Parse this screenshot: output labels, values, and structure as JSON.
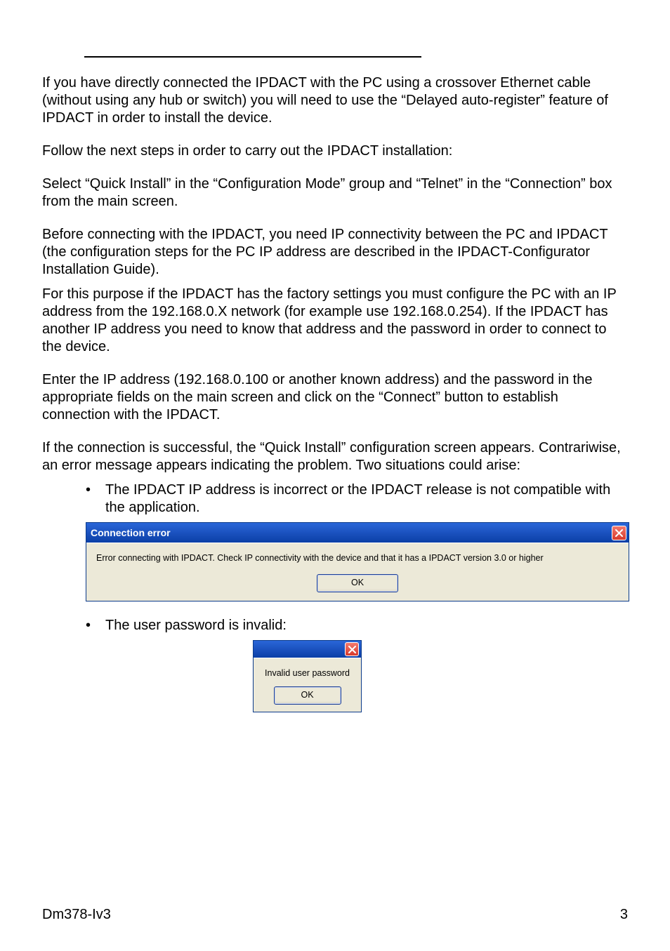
{
  "body": {
    "para1": "If you have directly connected the IPDACT with the PC using a crossover Ethernet cable (without using any hub or switch) you will need to use the “Delayed auto-register” feature of IPDACT in order to install the device.",
    "para2": "Follow the next steps in order to carry out the IPDACT installation:",
    "para3": "Select “Quick Install” in the “Configuration Mode” group and “Telnet” in the “Connection” box from the main screen.",
    "para4a": "Before connecting with the IPDACT, you need IP connectivity between the PC and IPDACT (the configuration steps for the PC IP address are described in the IPDACT-Configurator Installation Guide).",
    "para4b": "For this purpose if the IPDACT has the factory settings you must configure the PC with an IP address from the 192.168.0.X network (for example use 192.168.0.254). If the IPDACT has another IP address you need to know that address and the password in order to connect to the device.",
    "para5": "Enter the IP address (192.168.0.100 or another known address) and the password in the appropriate fields on the main screen and click on the “Connect” button to establish connection with the IPDACT.",
    "para6": "If the connection is successful, the “Quick Install” configuration screen appears. Contrariwise, an error message appears indicating the problem.  Two situations could arise:",
    "bullet1": "The IPDACT IP address is incorrect or the IPDACT release is not compatible with the application.",
    "bullet2": "The user password is invalid:"
  },
  "dialog1": {
    "title": "Connection error",
    "message": "Error connecting with IPDACT. Check IP connectivity with the device and that it has a IPDACT version 3.0 or higher",
    "ok": "OK"
  },
  "dialog2": {
    "message": "Invalid user password",
    "ok": "OK"
  },
  "footer": {
    "doc_id": "Dm378-Iv3",
    "page_no": "3"
  }
}
